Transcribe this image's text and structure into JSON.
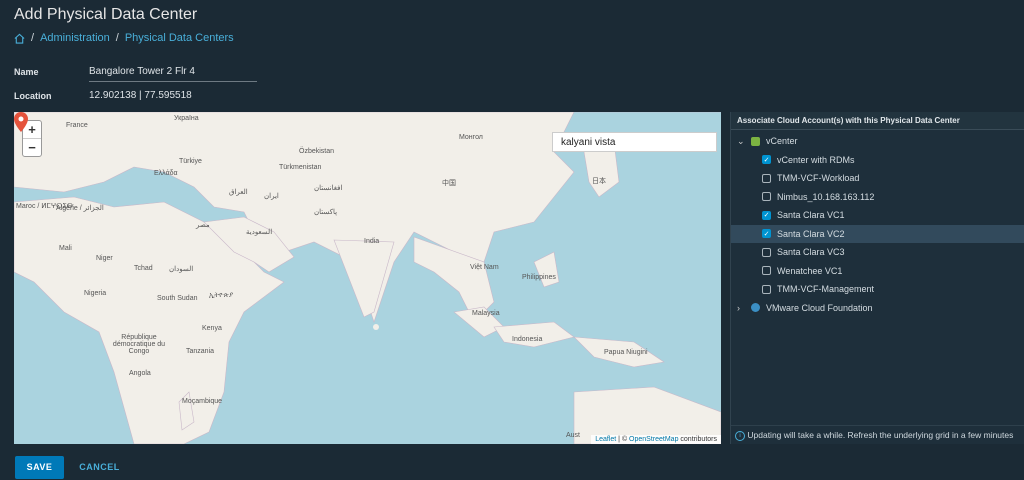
{
  "title": "Add Physical Data Center",
  "breadcrumb": {
    "items": [
      "Administration",
      "Physical Data Centers"
    ],
    "sep": "/"
  },
  "form": {
    "name_label": "Name",
    "name_value": "Bangalore Tower 2 Flr 4",
    "location_label": "Location",
    "location_value": "12.902138 | 77.595518"
  },
  "map": {
    "zoom_in": "+",
    "zoom_out": "−",
    "search_value": "kalyani vista",
    "labels": [
      "France",
      "Україна",
      "Türkiye",
      "Özbekistan",
      "Türkmenistan",
      "Монгол",
      "Ελλάδα",
      "ایران",
      "العراق",
      "افغانستان",
      "پاکستان",
      "中国",
      "日本",
      "India",
      "مصر",
      "السعودية",
      "Maroc / ⵍⵎⵖⵔⵉⴱ",
      "Algérie / الجزائر",
      "Mali",
      "Niger",
      "Tchad",
      "السودان",
      "Nigeria",
      "South Sudan",
      "ኢትዮጵያ",
      "Kenya",
      "République démocratique du Congo",
      "Tanzania",
      "Angola",
      "Moçambique",
      "Việt Nam",
      "Philippines",
      "Malaysia",
      "Indonesia",
      "Papua Niugini",
      "Aust"
    ],
    "attribution": {
      "leaflet": "Leaflet",
      "sep": " | © ",
      "osm": "OpenStreetMap",
      "rest": " contributors"
    }
  },
  "panel": {
    "header": "Associate Cloud Account(s) with this Physical Data Center",
    "groups": [
      {
        "label": "vCenter",
        "expanded": true,
        "items": [
          {
            "label": "vCenter with RDMs",
            "checked": true
          },
          {
            "label": "TMM-VCF-Workload",
            "checked": false
          },
          {
            "label": "Nimbus_10.168.163.112",
            "checked": false
          },
          {
            "label": "Santa Clara VC1",
            "checked": true
          },
          {
            "label": "Santa Clara VC2",
            "checked": true,
            "selected": true
          },
          {
            "label": "Santa Clara VC3",
            "checked": false
          },
          {
            "label": "Wenatchee VC1",
            "checked": false
          },
          {
            "label": "TMM-VCF-Management",
            "checked": false
          }
        ]
      },
      {
        "label": "VMware Cloud Foundation",
        "expanded": false,
        "items": []
      }
    ],
    "info": "Updating will take a while. Refresh the underlying grid in a few minutes"
  },
  "actions": {
    "save": "SAVE",
    "cancel": "CANCEL"
  },
  "colors": {
    "accent": "#0079b8",
    "link": "#49afd9",
    "water": "#aad3df",
    "land": "#f2efe9"
  }
}
